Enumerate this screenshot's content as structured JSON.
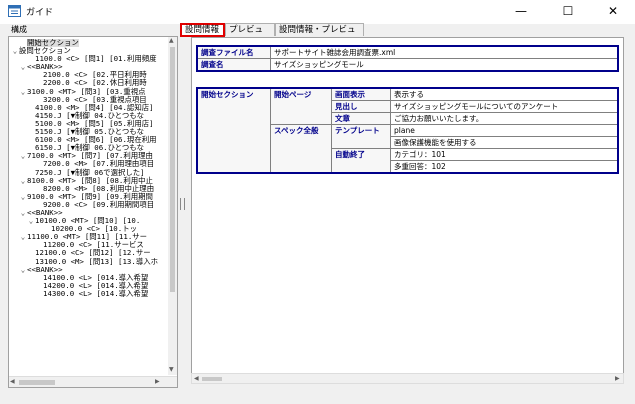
{
  "window": {
    "title": "ガイド",
    "minimize": "—",
    "maximize": "☐",
    "close": "✕"
  },
  "left": {
    "label": "構成",
    "tree": [
      {
        "t": "開始セクション",
        "toggle": "",
        "sel": true,
        "i": 1
      },
      {
        "t": "設問セクション",
        "toggle": "⌄",
        "i": 0
      },
      {
        "t": "1100.0 <C> [問1] [01.利用頻度",
        "toggle": "",
        "i": 2
      },
      {
        "t": "<<BANK>>",
        "toggle": "⌄",
        "i": 1
      },
      {
        "t": "2100.0 <C> [02.平日利用時",
        "toggle": "",
        "i": 3
      },
      {
        "t": "2200.0 <C> [02.休日利用時",
        "toggle": "",
        "i": 3
      },
      {
        "t": "3100.0 <MT> [問3] [03.重視点",
        "toggle": "⌄",
        "i": 1
      },
      {
        "t": "3200.0 <C> [03.重視点項目",
        "toggle": "",
        "i": 3
      },
      {
        "t": "4100.0 <M> [問4] [04.認知店]",
        "toggle": "",
        "i": 2
      },
      {
        "t": "4150.J [▼制御 04.ひとつもな",
        "toggle": "",
        "i": 2
      },
      {
        "t": "5100.0 <M> [問5] [05.利用店]",
        "toggle": "",
        "i": 2
      },
      {
        "t": "5150.J [▼制御 05.ひとつもな",
        "toggle": "",
        "i": 2
      },
      {
        "t": "6100.0 <M> [問6] [06.現在利用",
        "toggle": "",
        "i": 2
      },
      {
        "t": "6150.J [▼制御 06.ひとつもな",
        "toggle": "",
        "i": 2
      },
      {
        "t": "7100.0 <MT> [問7] [07.利用理由",
        "toggle": "⌄",
        "i": 1
      },
      {
        "t": "7200.0 <M> [07.利用理由項目",
        "toggle": "",
        "i": 3
      },
      {
        "t": "7250.J [▼制御 06で選択した]",
        "toggle": "",
        "i": 2
      },
      {
        "t": "8100.0 <MT> [問8] [08.利用中止",
        "toggle": "⌄",
        "i": 1
      },
      {
        "t": "8200.0 <M> [08.利用中止理由",
        "toggle": "",
        "i": 3
      },
      {
        "t": "9100.0 <MT> [問9] [09.利用期間",
        "toggle": "⌄",
        "i": 1
      },
      {
        "t": "9200.0 <C> [09.利用期間項目",
        "toggle": "",
        "i": 3
      },
      {
        "t": "<<BANK>>",
        "toggle": "⌄",
        "i": 1
      },
      {
        "t": "10100.0 <MT> [問10] [10.",
        "toggle": "⌄",
        "i": 2
      },
      {
        "t": "10200.0 <C> [10.トッ",
        "toggle": "",
        "i": 4
      },
      {
        "t": "11100.0 <MT> [問11] [11.サー",
        "toggle": "⌄",
        "i": 1
      },
      {
        "t": "11200.0 <C> [11.サービス",
        "toggle": "",
        "i": 3
      },
      {
        "t": "12100.0 <C> [問12] [12.サー",
        "toggle": "",
        "i": 2
      },
      {
        "t": "13100.0 <M> [問13] [13.導入ホ",
        "toggle": "",
        "i": 2
      },
      {
        "t": "<<BANK>>",
        "toggle": "⌄",
        "i": 1
      },
      {
        "t": "14100.0 <L> [014.導入希望",
        "toggle": "",
        "i": 3
      },
      {
        "t": "14200.0 <L> [014.導入希望",
        "toggle": "",
        "i": 3
      },
      {
        "t": "14300.0 <L> [014.導入希望",
        "toggle": "",
        "i": 3
      }
    ]
  },
  "tabs": [
    "設問情報",
    "プレビュー",
    "設問情報・プレビュー"
  ],
  "survey": {
    "file_label": "調査ファイル名",
    "file_value": "サポートサイト雑誌会用調査票.xml",
    "name_label": "調査名",
    "name_value": "サイズショッピングモール"
  },
  "section": {
    "label": "開始セクション",
    "start_page": "開始ページ",
    "display_label": "画面表示",
    "display_value": "表示する",
    "heading_label": "見出し",
    "heading_value": "サイズショッピングモールについてのアンケート",
    "text_label": "文章",
    "text_value": "ご協力お願いいたします。",
    "spec": "スペック全般",
    "template_label": "テンプレート",
    "template_value": "plane",
    "template_note": "画像保護機能を使用する",
    "auto_end_label": "自動終了",
    "category_label": "カテゴリ：101",
    "multiple_label": "多重回答：102"
  }
}
